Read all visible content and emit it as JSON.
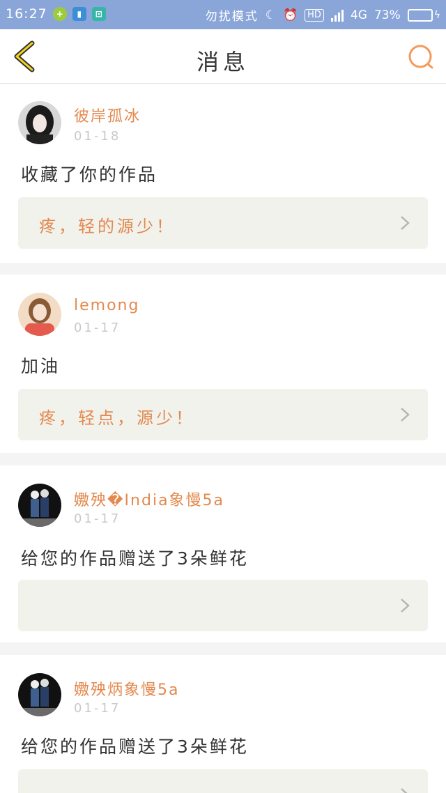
{
  "status_bar": {
    "time": "16:27",
    "mode": "勿扰模式",
    "hd": "HD",
    "network": "4G",
    "battery": "73%",
    "battery_level": 0.73,
    "icons": [
      "moon-icon",
      "alarm-icon",
      "signal-icon",
      "battery-icon"
    ]
  },
  "header": {
    "title": "消息",
    "accent": "#f39a5a"
  },
  "messages": [
    {
      "user": "彼岸孤冰",
      "date": "01-18",
      "text": "收藏了你的作品",
      "quote": "疼，轻的源少！"
    },
    {
      "user": "lemong",
      "date": "01-17",
      "text": "加油",
      "quote": "疼，轻点，源少！"
    },
    {
      "user": "嫐殃�India象慢5a",
      "date": "01-17",
      "text": "给您的作品赠送了3朵鲜花",
      "quote": ""
    },
    {
      "user": "嫐殃炳象慢5a",
      "date": "01-17",
      "text": "给您的作品赠送了3朵鲜花",
      "quote": ""
    }
  ]
}
